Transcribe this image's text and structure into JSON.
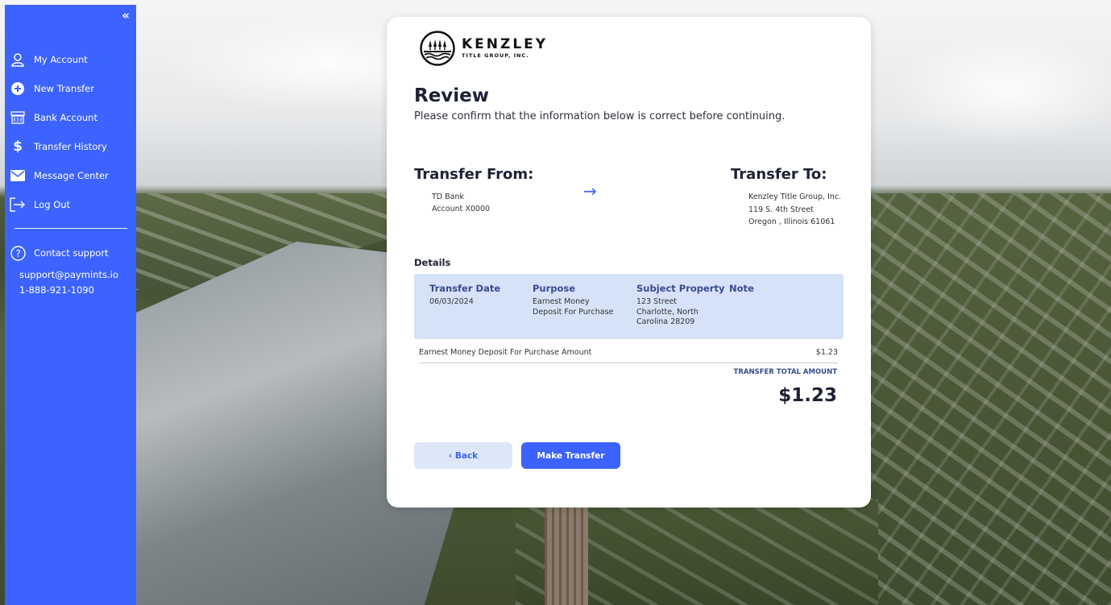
{
  "sidebar": {
    "collapse_glyph": "«",
    "items": [
      {
        "label": "My Account",
        "icon": "user-icon"
      },
      {
        "label": "New Transfer",
        "icon": "plus-circle-icon"
      },
      {
        "label": "Bank Account",
        "icon": "bank-icon"
      },
      {
        "label": "Transfer History",
        "icon": "dollar-icon"
      },
      {
        "label": "Message Center",
        "icon": "mail-icon"
      },
      {
        "label": "Log Out",
        "icon": "logout-icon"
      }
    ],
    "support": {
      "label": "Contact support",
      "email": "support@paymints.io",
      "phone": "1-888-921-1090"
    }
  },
  "logo": {
    "name": "KENZLEY",
    "sub": "TITLE GROUP, INC."
  },
  "review": {
    "title": "Review",
    "subtitle": "Please confirm that the information below is correct before continuing."
  },
  "from": {
    "heading": "Transfer From:",
    "bank": "TD Bank",
    "account": "Account X0000"
  },
  "arrow": "→",
  "to": {
    "heading": "Transfer To:",
    "name": "Kenzley Title Group, Inc.",
    "street": "119 S. 4th Street",
    "city": "Oregon , Illinois 61061"
  },
  "details": {
    "heading": "Details",
    "transfer_date_label": "Transfer Date",
    "transfer_date": "06/03/2024",
    "purpose_label": "Purpose",
    "purpose_line1": "Earnest Money",
    "purpose_line2": "Deposit For Purchase",
    "property_label": "Subject Property",
    "property_line1": "123 Street",
    "property_line2": "Charlotte, North",
    "property_line3": "Carolina 28209",
    "note_label": "Note"
  },
  "amount": {
    "label": "Earnest Money Deposit For Purchase Amount",
    "value": "$1.23",
    "total_label": "TRANSFER TOTAL AMOUNT",
    "total": "$1.23"
  },
  "buttons": {
    "back": "‹ Back",
    "make": "Make Transfer"
  },
  "colors": {
    "accent": "#3c63ff",
    "details_bg": "#d5e2f7",
    "heading": "#1d2133"
  }
}
